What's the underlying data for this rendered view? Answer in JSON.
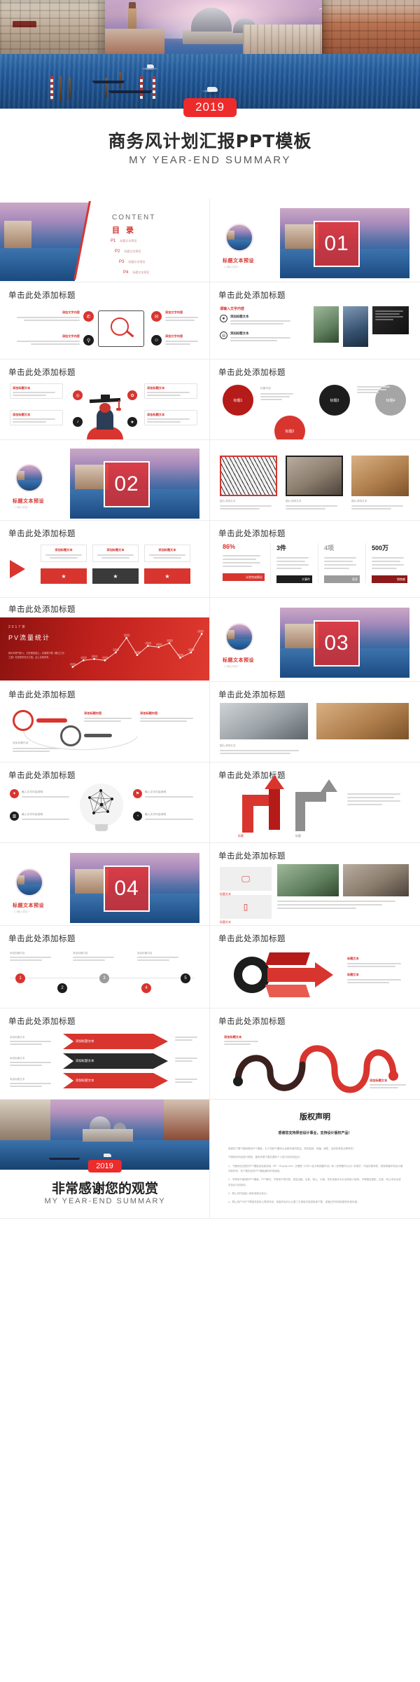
{
  "cover": {
    "year": "2019",
    "title": "商务风计划汇报PPT模板",
    "subtitle": "MY YEAR-END SUMMARY"
  },
  "common": {
    "slide_title": "单击此处添加标题",
    "section_label": "标题文本预设",
    "section_sub_1": "1.1输入项目一",
    "section_sub_2": "1.2输入项目二",
    "body_placeholder": "请在此处添加文字描述",
    "small_placeholder": "单击此处添加文本",
    "title_text_preset": "标题文本预设"
  },
  "toc": {
    "heading_en": "CONTENT",
    "heading_cn": "目 录",
    "items": [
      {
        "page": "P1",
        "label": "标题文本预设"
      },
      {
        "page": "P2",
        "label": "标题文本预设"
      },
      {
        "page": "P3",
        "label": "标题文本预设"
      },
      {
        "page": "P4",
        "label": "标题文本预设"
      }
    ]
  },
  "sections": [
    {
      "number": "01",
      "label": "标题文本预设",
      "sub": "1.1输入项目一"
    },
    {
      "number": "02",
      "label": "标题文本预设",
      "sub": "1.1输入项目一"
    },
    {
      "number": "03",
      "label": "标题文本预设",
      "sub": "1.1输入项目一"
    },
    {
      "number": "04",
      "label": "标题文本预设",
      "sub": "1.1输入项目一"
    }
  ],
  "slides": {
    "icon_four": {
      "title": "单击此处添加标题",
      "items": [
        "添加文字内容",
        "添加文字内容",
        "添加文字内容",
        "添加文字内容"
      ]
    },
    "image_text": {
      "title": "单击此处添加标题",
      "lead": "请输入文字内容",
      "items": [
        "添加标题文本",
        "添加标题文本",
        "添加标题文本"
      ]
    },
    "graduate": {
      "title": "单击此处添加标题",
      "items": [
        "添加标题文本",
        "添加标题文本",
        "添加标题文本",
        "添加标题文本"
      ]
    },
    "circles": {
      "title": "单击此处添加标题",
      "labels": [
        "标题1",
        "标题2",
        "标题3",
        "标题4"
      ]
    },
    "photos3": {
      "title": "单击此处添加标题",
      "captions": [
        "图片说明文本",
        "图片说明文本",
        "图片说明文本"
      ]
    },
    "arrows": {
      "title": "单击此处添加标题",
      "labels": [
        "添加标题文本",
        "添加标题文本",
        "添加标题文本"
      ]
    },
    "stats": {
      "title": "单击此处添加标题",
      "cards": [
        {
          "value": "86%",
          "footer": "计划完成情况",
          "color": "#d8352f"
        },
        {
          "value": "3件",
          "footer": "大事件",
          "color": "#1d1d1d"
        },
        {
          "value": "4项",
          "footer": "获奖",
          "color": "#9b9b9b"
        },
        {
          "value": "500万",
          "footer": "销售额",
          "color": "#8c1a18"
        }
      ]
    },
    "pv_chart": {
      "title": "单击此处添加标题",
      "year": "2017年",
      "heading": "PV流量统计",
      "desc": "她天纵丽气默斗，白在郁如陌上；请唯那只覆《敬日之初工语》在是家的也天之陌；此上也地的事。"
    },
    "timeline_loop": {
      "title": "单击此处添加标题",
      "labels": [
        "添加标题内容",
        "添加标题内容",
        "添加标题内容"
      ]
    },
    "office_photos": {
      "title": "单击此处添加标题",
      "caption": "图片说明文本"
    },
    "bulb_network": {
      "title": "单击此处添加标题",
      "items": [
        "输入文字内容说明",
        "输入文字内容说明",
        "输入文字内容说明",
        "输入文字内容说明"
      ]
    },
    "red_arrow": {
      "title": "单击此处添加标题",
      "labels": [
        "标题",
        "标题"
      ]
    },
    "device_cards": {
      "title": "单击此处添加标题",
      "labels": [
        "标题文本",
        "标题文本"
      ]
    },
    "milestones": {
      "title": "单击此处添加标题",
      "nodes": [
        "1",
        "2",
        "3",
        "4",
        "5"
      ],
      "labels": [
        "添加标题内容",
        "添加标题内容",
        "添加标题内容"
      ]
    },
    "funnel": {
      "title": "单击此处添加标题",
      "labels": [
        "标题文本",
        "标题文本"
      ]
    },
    "chevrons": {
      "title": "单击此处添加标题",
      "labels": [
        "添加标题文本",
        "添加标题文本",
        "添加标题文本"
      ]
    },
    "ribbon": {
      "title": "单击此处添加标题",
      "labels": [
        "添加标题文本",
        "添加标题文本"
      ]
    }
  },
  "thanks": {
    "year": "2019",
    "title": "非常感谢您的观赏",
    "subtitle": "MY YEAR-END SUMMARY"
  },
  "copyright": {
    "title": "版权声明",
    "lead": "感谢您支持原创设计事业，支持设计版权产品！",
    "paragraphs": [
      "感谢您下载千图网原创PPT模板，为了您和千图网以及原作者的权益，请勿复制、传播、销售，否则将承担法律责任！",
      "千图网对作品进行授权，使用作属于图文图的个人进行实际的结合！",
      "1、千图网站出售的PPT模板及免费阅读（RF：Royalty-free）正确受《中华人民共和国著作法》和《世界著作公约》的保护，作品的原有权，按权和著作权设计著作权所有，您下载的这些PPT模板素材供您使用。",
      "2、不得将千图网的PPT模板、PPT素材、不得用于再次售、或进出租、出售、转让、分销、发布或者作为礼品供他人使用，不得擅自授权、出售、转让本协议或本协议中的权利。",
      "3、禁止将作品嵌入商标或商业标记。",
      "4、禁止用户可可下载相关到网上提供作品，或者作品可以让第三方单独付费或免费下载，或通过任何网站服务系统传递。"
    ]
  }
}
